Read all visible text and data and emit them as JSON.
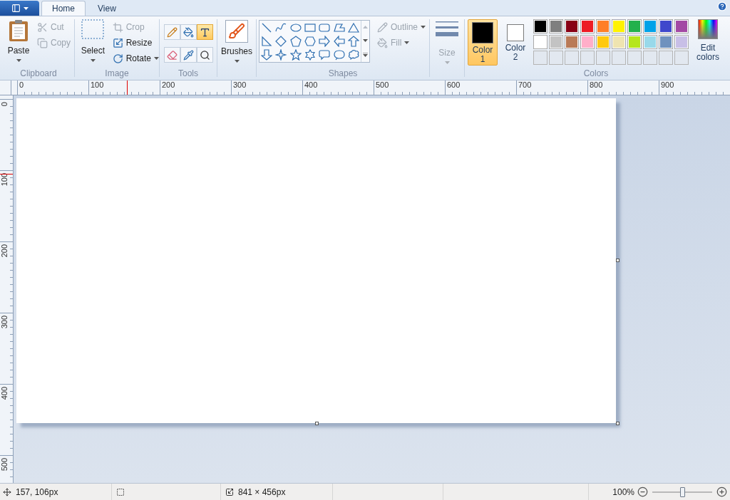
{
  "tabs": [
    {
      "label": "Home",
      "selected": true
    },
    {
      "label": "View",
      "selected": false
    }
  ],
  "clipboard": {
    "group_label": "Clipboard",
    "paste": "Paste",
    "cut": {
      "label": "Cut",
      "disabled": true
    },
    "copy": {
      "label": "Copy",
      "disabled": true
    }
  },
  "image": {
    "group_label": "Image",
    "select": "Select",
    "crop": {
      "label": "Crop",
      "disabled": true
    },
    "resize": {
      "label": "Resize",
      "disabled": false
    },
    "rotate": {
      "label": "Rotate",
      "disabled": false
    }
  },
  "tools": {
    "group_label": "Tools",
    "items": [
      {
        "kind": "pencil",
        "selected": false
      },
      {
        "kind": "fill",
        "selected": false
      },
      {
        "kind": "text",
        "selected": true
      },
      {
        "kind": "eraser",
        "selected": false
      },
      {
        "kind": "picker",
        "selected": false
      },
      {
        "kind": "magnifier",
        "selected": false
      }
    ]
  },
  "brushes": {
    "label": "Brushes"
  },
  "shapes": {
    "group_label": "Shapes",
    "items": [
      {
        "kind": "line"
      },
      {
        "kind": "curve"
      },
      {
        "kind": "oval"
      },
      {
        "kind": "rectangle"
      },
      {
        "kind": "rounded-rectangle"
      },
      {
        "kind": "polygon"
      },
      {
        "kind": "triangle"
      },
      {
        "kind": "right-triangle"
      },
      {
        "kind": "diamond"
      },
      {
        "kind": "pentagon"
      },
      {
        "kind": "hexagon"
      },
      {
        "kind": "right-arrow"
      },
      {
        "kind": "left-arrow"
      },
      {
        "kind": "up-arrow"
      },
      {
        "kind": "down-arrow"
      },
      {
        "kind": "four-point-star"
      },
      {
        "kind": "five-point-star"
      },
      {
        "kind": "six-point-star"
      },
      {
        "kind": "rounded-callout"
      },
      {
        "kind": "oval-callout"
      },
      {
        "kind": "cloud-callout"
      }
    ],
    "outline": {
      "label": "Outline",
      "disabled": true
    },
    "fill": {
      "label": "Fill",
      "disabled": true
    }
  },
  "size": {
    "label": "Size",
    "disabled": true
  },
  "colors": {
    "group_label": "Colors",
    "color_1": {
      "label": "Color 1",
      "color": "#000000",
      "selected": true
    },
    "color_2": {
      "label": "Color 2",
      "color": "#ffffff",
      "selected": false
    },
    "palette": [
      {
        "color": "#000000"
      },
      {
        "color": "#7f7f7f"
      },
      {
        "color": "#880015"
      },
      {
        "color": "#ed1c24"
      },
      {
        "color": "#ff7f27"
      },
      {
        "color": "#fff200"
      },
      {
        "color": "#22b14c"
      },
      {
        "color": "#00a2e8"
      },
      {
        "color": "#3f48cc"
      },
      {
        "color": "#a349a4"
      },
      {
        "color": "#ffffff"
      },
      {
        "color": "#c3c3c3"
      },
      {
        "color": "#b97a57"
      },
      {
        "color": "#ffaec9"
      },
      {
        "color": "#ffc90e"
      },
      {
        "color": "#efe4b0"
      },
      {
        "color": "#b5e61d"
      },
      {
        "color": "#99d9ea"
      },
      {
        "color": "#7092be"
      },
      {
        "color": "#c8bfe7"
      }
    ],
    "edit_colors": "Edit colors"
  },
  "rulers": {
    "horizontal": [
      "0",
      "100",
      "200",
      "300",
      "400",
      "500",
      "600",
      "700",
      "800",
      "900"
    ],
    "vertical": [
      "0",
      "100",
      "200",
      "300",
      "400",
      "500"
    ]
  },
  "status_bar": {
    "position": "157, 106px",
    "image_size": "841 × 456px",
    "zoom": "100%",
    "zoom_level": {
      "level": 0.5
    }
  }
}
